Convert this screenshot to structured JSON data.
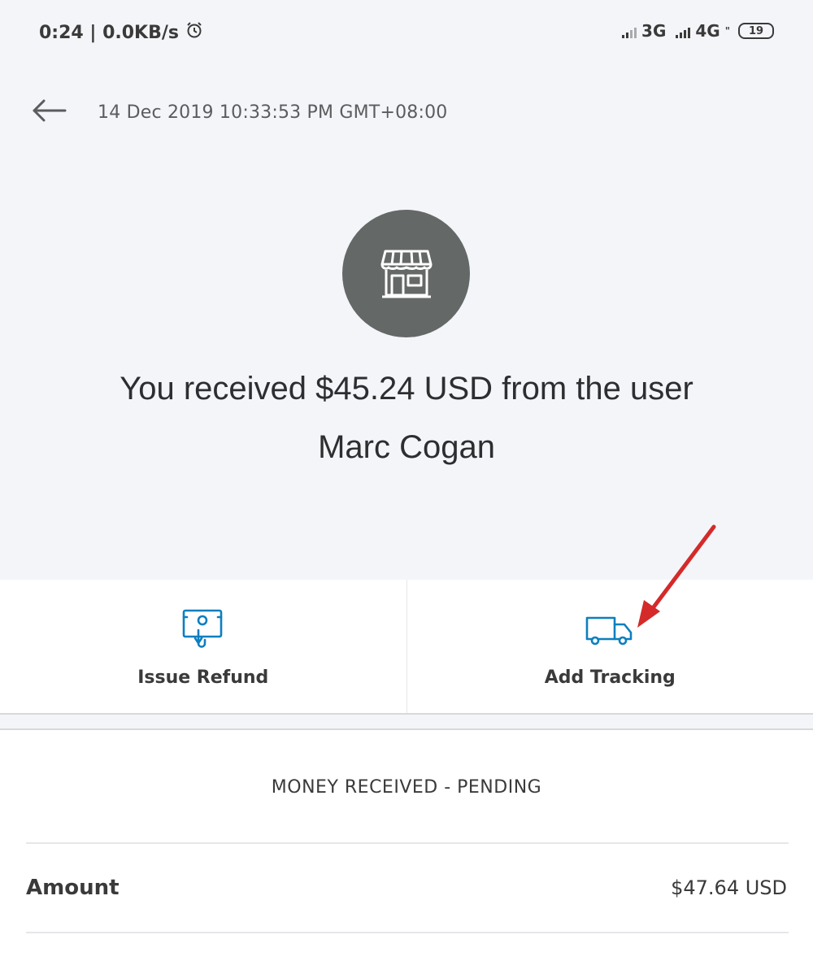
{
  "status_bar": {
    "left_text": "0:24 | 0.0KB/s",
    "alarm_icon": "alarm-clock-icon",
    "network_3g": "3G",
    "network_4g": "4G",
    "network_4g_suffix": "\"",
    "battery": "19"
  },
  "header": {
    "back_icon": "back-arrow-icon",
    "date": "14 Dec 2019 10:33:53 PM GMT+08:00"
  },
  "transaction": {
    "avatar_icon": "storefront-icon",
    "headline": "You received $45.24 USD from the user",
    "name": "Marc Cogan"
  },
  "actions": [
    {
      "label": "Issue Refund",
      "icon": "refund-icon"
    },
    {
      "label": "Add Tracking",
      "icon": "delivery-truck-icon"
    }
  ],
  "details": {
    "status": "MONEY RECEIVED - PENDING",
    "amount_label": "Amount",
    "amount_value": "$47.64 USD"
  },
  "colors": {
    "background_top": "#f4f5f8",
    "avatar": "#646867",
    "icon_accent": "#0d7fbf",
    "annotation_arrow": "#d42a2a"
  }
}
